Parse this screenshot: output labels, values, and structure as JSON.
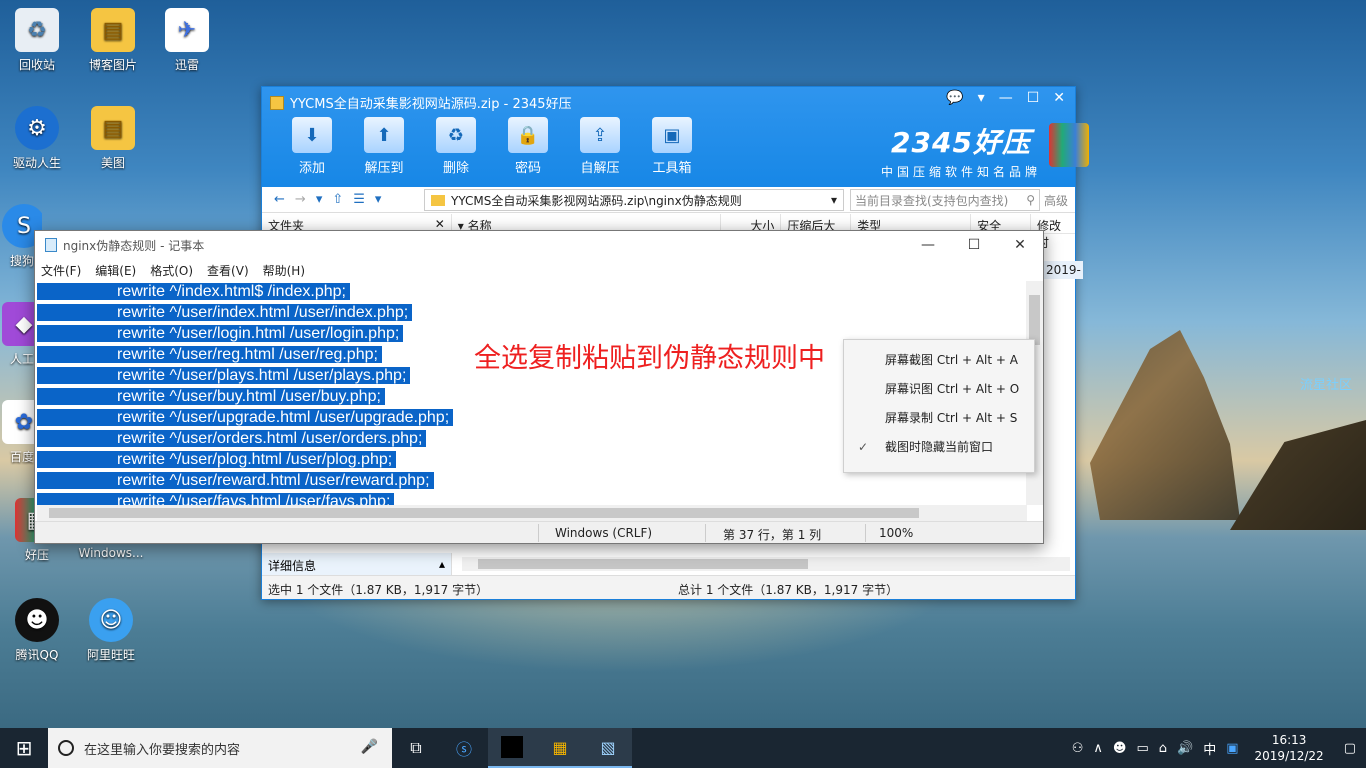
{
  "desktop": {
    "icons": [
      {
        "label": "回收站",
        "icon": "recycle-bin-icon"
      },
      {
        "label": "博客图片",
        "icon": "folder-icon"
      },
      {
        "label": "迅雷",
        "icon": "thunder-icon"
      },
      {
        "label": "驱动人生",
        "icon": "gear-icon"
      },
      {
        "label": "美图",
        "icon": "folder-icon"
      },
      {
        "label": "搜狗",
        "icon": "sogou-icon"
      },
      {
        "label": "人工",
        "icon": "app-icon"
      },
      {
        "label": "百度",
        "icon": "baidu-icon"
      },
      {
        "label": "好压",
        "icon": "archive-icon"
      },
      {
        "label": "Windows...",
        "icon": "folder-icon"
      },
      {
        "label": "腾讯QQ",
        "icon": "qq-icon"
      },
      {
        "label": "阿里旺旺",
        "icon": "aliwangwang-icon"
      }
    ],
    "watermark": "流星社区"
  },
  "zip_window": {
    "title": "YYCMS全自动采集影视网站源码.zip - 2345好压",
    "toolbar": [
      "添加",
      "解压到",
      "删除",
      "密码",
      "自解压",
      "工具箱"
    ],
    "brand": "2345好压",
    "brand_sub": "中国压缩软件知名品牌",
    "path": "YYCMS全自动采集影视网站源码.zip\\nginx伪静态规则",
    "search_placeholder": "当前目录查找(支持包内查找)",
    "advanced": "高级",
    "sidebar_header": "文件夹",
    "columns": [
      "名称",
      "大小",
      "压缩后大小",
      "类型",
      "安全",
      "修改时"
    ],
    "row_date": "2019-",
    "detail": "详细信息",
    "status_left": "选中 1 个文件（1.87 KB，1,917 字节）",
    "status_right": "总计 1 个文件（1.87 KB，1,917 字节）"
  },
  "notepad": {
    "title": "nginx伪静态规则 - 记事本",
    "menu": [
      "文件(F)",
      "编辑(E)",
      "格式(O)",
      "查看(V)",
      "帮助(H)"
    ],
    "lines": [
      "rewrite ^/index.html$ /index.php;",
      "rewrite ^/user/index.html /user/index.php;",
      "rewrite ^/user/login.html /user/login.php;",
      "rewrite ^/user/reg.html /user/reg.php;",
      "rewrite ^/user/plays.html /user/plays.php;",
      "rewrite ^/user/buy.html /user/buy.php;",
      "rewrite ^/user/upgrade.html /user/upgrade.php;",
      "rewrite ^/user/orders.html /user/orders.php;",
      "rewrite ^/user/plog.html /user/plog.php;",
      "rewrite ^/user/reward.html /user/reward.php;",
      "rewrite ^/user/favs.html /user/favs.php;"
    ],
    "status": {
      "encoding": "Windows (CRLF)",
      "position": "第 37 行，第 1 列",
      "zoom": "100%"
    }
  },
  "overlay_text": "全选复制粘贴到伪静态规则中",
  "context_menu": {
    "items": [
      {
        "label": "屏幕截图 Ctrl + Alt + A",
        "checked": false
      },
      {
        "label": "屏幕识图 Ctrl + Alt + O",
        "checked": false
      },
      {
        "label": "屏幕录制 Ctrl + Alt + S",
        "checked": false
      },
      {
        "label": "截图时隐藏当前窗口",
        "checked": true
      }
    ]
  },
  "taskbar": {
    "search_placeholder": "在这里输入你要搜索的内容",
    "ime": "中",
    "time": "16:13",
    "date": "2019/12/22"
  }
}
